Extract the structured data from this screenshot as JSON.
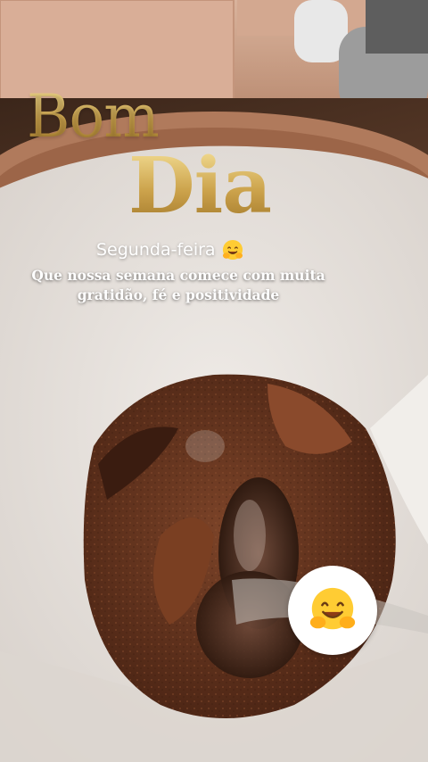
{
  "greeting": {
    "line1": "Bom",
    "line2": "Dia",
    "weekday": "Segunda-feira",
    "message_line1": "Que nossa semana comece com muita",
    "message_line2": "gratidão, fé e positividade"
  },
  "icons": {
    "inline_emoji": "hugging-face-icon",
    "sticker": "hugging-face-icon"
  },
  "colors": {
    "gold": "#d5b25a",
    "text": "#ffffff",
    "filter_paper": "#e6e1dc",
    "coffee": "#6b3a22"
  }
}
